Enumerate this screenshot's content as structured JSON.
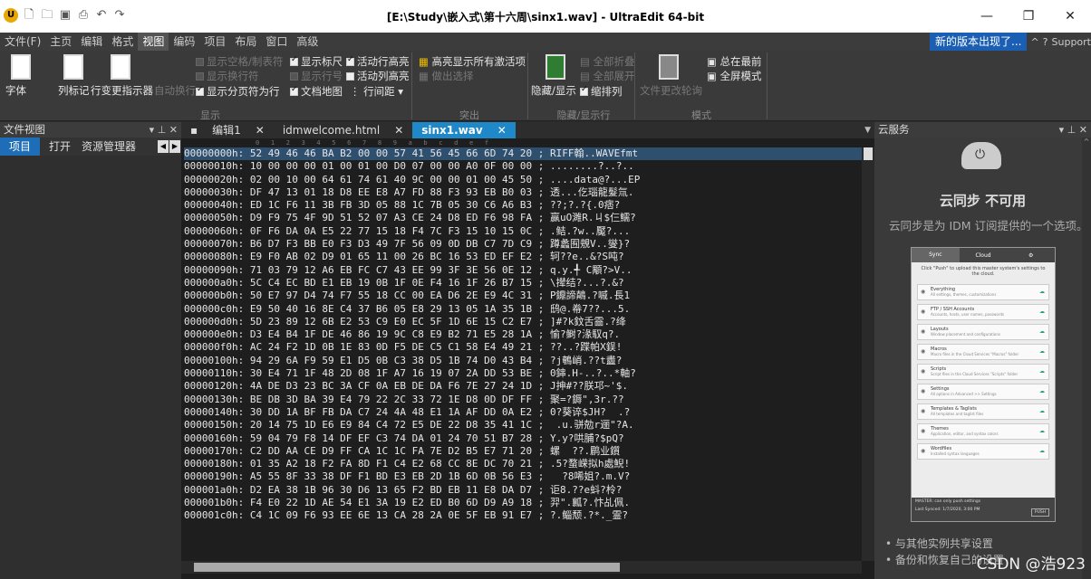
{
  "window": {
    "title": "[E:\\Study\\嵌入式\\第十六周\\sinx1.wav] - UltraEdit 64-bit",
    "min": "—",
    "max": "❐",
    "close": "✕"
  },
  "quick_access": [
    "logo-icon",
    "new-file-icon",
    "open-folder-icon",
    "save-icon",
    "print-icon",
    "undo-icon",
    "redo-icon"
  ],
  "menu": {
    "items": [
      "文件(F)",
      "主页",
      "编辑",
      "格式",
      "视图",
      "编码",
      "项目",
      "布局",
      "窗口",
      "高级"
    ],
    "active_index": 4,
    "new_version": "新的版本出现了...",
    "support": "Support"
  },
  "ribbon": {
    "font_label": "字体",
    "column_marker_label": "列标记",
    "line_change_label": "行变更指示器",
    "auto_wrap_label": "自动换行",
    "show_spaces": "显示空格/制表符",
    "show_line_endings": "显示换行符",
    "show_page_breaks": "显示分页符为行",
    "show_ruler": "显示标尺",
    "show_line_numbers": "显示行号",
    "document_map": "文档地图",
    "active_row_highlight": "活动行高亮",
    "active_col_highlight": "活动列高亮",
    "line_spacing": "行间距",
    "highlight_all_active": "高亮显示所有激活项",
    "make_selection": "做出选择",
    "hide_show": "隐藏/显示",
    "collapse_all": "全部折叠",
    "expand_all": "全部展开",
    "indent": "缩排列",
    "file_change_poll": "文件更改轮询",
    "always_on_top": "总在最前",
    "fullscreen": "全屏模式",
    "groups": [
      "显示",
      "突出",
      "隐藏/显示行",
      "模式"
    ]
  },
  "left_panel": {
    "title": "文件视图",
    "tabs": [
      "项目",
      "打开",
      "资源管理器"
    ]
  },
  "editor": {
    "tabs": [
      {
        "label": "编辑1",
        "close": "✕"
      },
      {
        "label": "idmwelcome.html",
        "close": "✕"
      },
      {
        "label": "sinx1.wav",
        "close": "✕"
      }
    ],
    "ruler": "0   1   2   3   4   5   6   7   8   9   a   b   c   d   e   f",
    "rows": [
      "00000000h: 52 49 46 46 BA B2 00 00 57 41 56 45 66 6D 74 20 ; RIFF翰..WAVEfmt",
      "00000010h: 10 00 00 00 01 00 01 00 D0 07 00 00 A0 0F 00 00 ; ........?..?..",
      "00000020h: 02 00 10 00 64 61 74 61 40 9C 00 00 01 00 45 50 ; ....data@?...EP",
      "00000030h: DF 47 13 01 18 D8 EE E8 A7 FD 88 F3 93 EB B0 03 ; 透...仡瑙龍髮氚.",
      "00000040h: ED 1C F6 11 3B FB 3D 05 88 1C 7B 05 30 C6 A6 B3 ; ??;?.?{.0痞?",
      "00000050h: D9 F9 75 4F 9D 51 52 07 A3 CE 24 D8 ED F6 98 FA ; 赢uO濉R.ㄐ$仨鱬?",
      "00000060h: 0F F6 DA 0A E5 22 77 15 18 F4 7C F3 15 10 15 0C ; .鲒.?w..魘?...",
      "00000070h: B6 D7 F3 BB E0 F3 D3 49 7F 56 09 0D DB C7 7D C9 ; 蹲蠡囿覫V..燮}?",
      "00000080h: E9 F0 AB 02 D9 01 65 11 00 26 BC 16 53 ED EF E2 ; 轲??e..&?S吨?",
      "00000090h: 71 03 79 12 A6 EB FC C7 43 EE 99 3F 3E 56 0E 12 ; q.y.╃ C顒?>V..",
      "000000a0h: 5C C4 EC BD E1 EB 19 0B 1F 0E F4 16 1F 26 B7 15 ; \\撵结?...?.&?",
      "000000b0h: 50 E7 97 D4 74 F7 55 18 CC 00 EA D6 2E E9 4C 31 ; P鐤諦鷏.?嘁.長1",
      "000000c0h: E9 50 40 16 8E C4 37 B6 05 E8 29 13 05 1A 35 1B ; 鸱@.帣7??...5.",
      "000000d0h: 5D 23 89 12 6B E2 53 C9 E0 EC 5F 1D 6E 15 C2 E7 ; ]#?k鈫舌霝.?绛",
      "000000e0h: D3 E4 B4 1F DE 46 86 19 9C C8 E9 B2 71 E5 28 1A ; 愉?鲥?湪馭q?.",
      "000000f0h: AC 24 F2 1D 0B 1E 83 0D F5 DE C5 C1 58 E4 49 21 ; ??..?蹀帕X鋘!",
      "00000100h: 94 29 6A F9 59 E1 D5 0B C3 38 D5 1B 74 D0 43 B4 ; ?j鵪峭.??t衋?",
      "00000110h: 30 E4 71 1F 48 2D 08 1F A7 16 19 07 2A DD 53 BE ; 0鋛.H-..?..*軸?",
      "00000120h: 4A DE D3 23 BC 3A CF 0A EB DE DA F6 7E 27 24 1D ; J抻#??朕邛~'$.",
      "00000130h: BE DB 3D BA 39 E4 79 22 2C 33 72 1E D8 0D DF FF ; 聚=?鎒\",3r.??",
      "00000140h: 30 DD 1A BF FB DA C7 24 4A 48 E1 1A AF DD 0A E2 ; 0?葵谇$JH?  .?",
      "00000150h: 20 14 75 1D E6 E9 84 C4 72 E5 DE 22 D8 35 41 1C ;  .u.骈勊r逦\"?A.",
      "00000160h: 59 04 79 F8 14 DF EF C3 74 DA 01 24 70 51 B7 28 ; Y.y?哄脯?$pQ?",
      "00000170h: C2 DD AA CE D9 FF CA 1C 1C FA 7E D2 B5 E7 71 20 ; 螺  ??.鹛业鑕",
      "00000180h: 01 35 A2 18 F2 FA 8D F1 C4 E2 68 CC 8E DC 70 21 ; .5?蝥嵘拟h處鯢!",
      "00000190h: A5 55 8F 33 38 DF F1 BD E3 EB 2D 1B 6D 0B 56 E3 ;   ?8唏姐?.m.V?",
      "000001a0h: D2 EA 38 1B 96 30 D6 13 65 F2 BD EB 11 E8 DA D7 ; 讵8.??e蚪?柃?",
      "000001b0h: F4 E0 22 1D AE 54 E1 3A 19 E2 ED B0 6D D9 A9 18 ; 羿\".瓤?.忭乩佩.",
      "000001c0h: C4 1C 09 F6 93 EE 6E 13 CA 28 2A 0E 5F EB 91 E7 ; ?.鲻颓.?*._霊?"
    ]
  },
  "right_panel": {
    "title": "云服务",
    "heading": "云同步 不可用",
    "sub": "云同步是为 IDM 订阅提供的一个选项。",
    "sync": {
      "tab_sync": "Sync",
      "tab_cloud": "Cloud",
      "message": "Click \"Push\" to upload this master system's settings to the cloud.",
      "items": [
        {
          "name": "Everything",
          "desc": "All settings, themes, customizations"
        },
        {
          "name": "FTP / SSH Accounts",
          "desc": "Accounts, hosts, user names, passwords"
        },
        {
          "name": "Layouts",
          "desc": "Window placement and configurations"
        },
        {
          "name": "Macros",
          "desc": "Macro files in the Cloud Services \"Macros\" folder"
        },
        {
          "name": "Scripts",
          "desc": "Script files in the Cloud Services \"Scripts\" folder"
        },
        {
          "name": "Settings",
          "desc": "All options in Advanced >> Settings"
        },
        {
          "name": "Templates & Taglists",
          "desc": "All templates and taglist files"
        },
        {
          "name": "Themes",
          "desc": "Application, editor, and syntax colors"
        },
        {
          "name": "Wordfiles",
          "desc": "Installed syntax languages"
        }
      ],
      "footer_note": "MASTER: can only push settings",
      "last_synced": "Last Synced: 1/7/2020, 3:00 PM",
      "push": "PUSH"
    },
    "links": [
      "与其他实例共享设置",
      "备份和恢复自己的设置"
    ]
  },
  "watermark": "CSDN @浩923"
}
